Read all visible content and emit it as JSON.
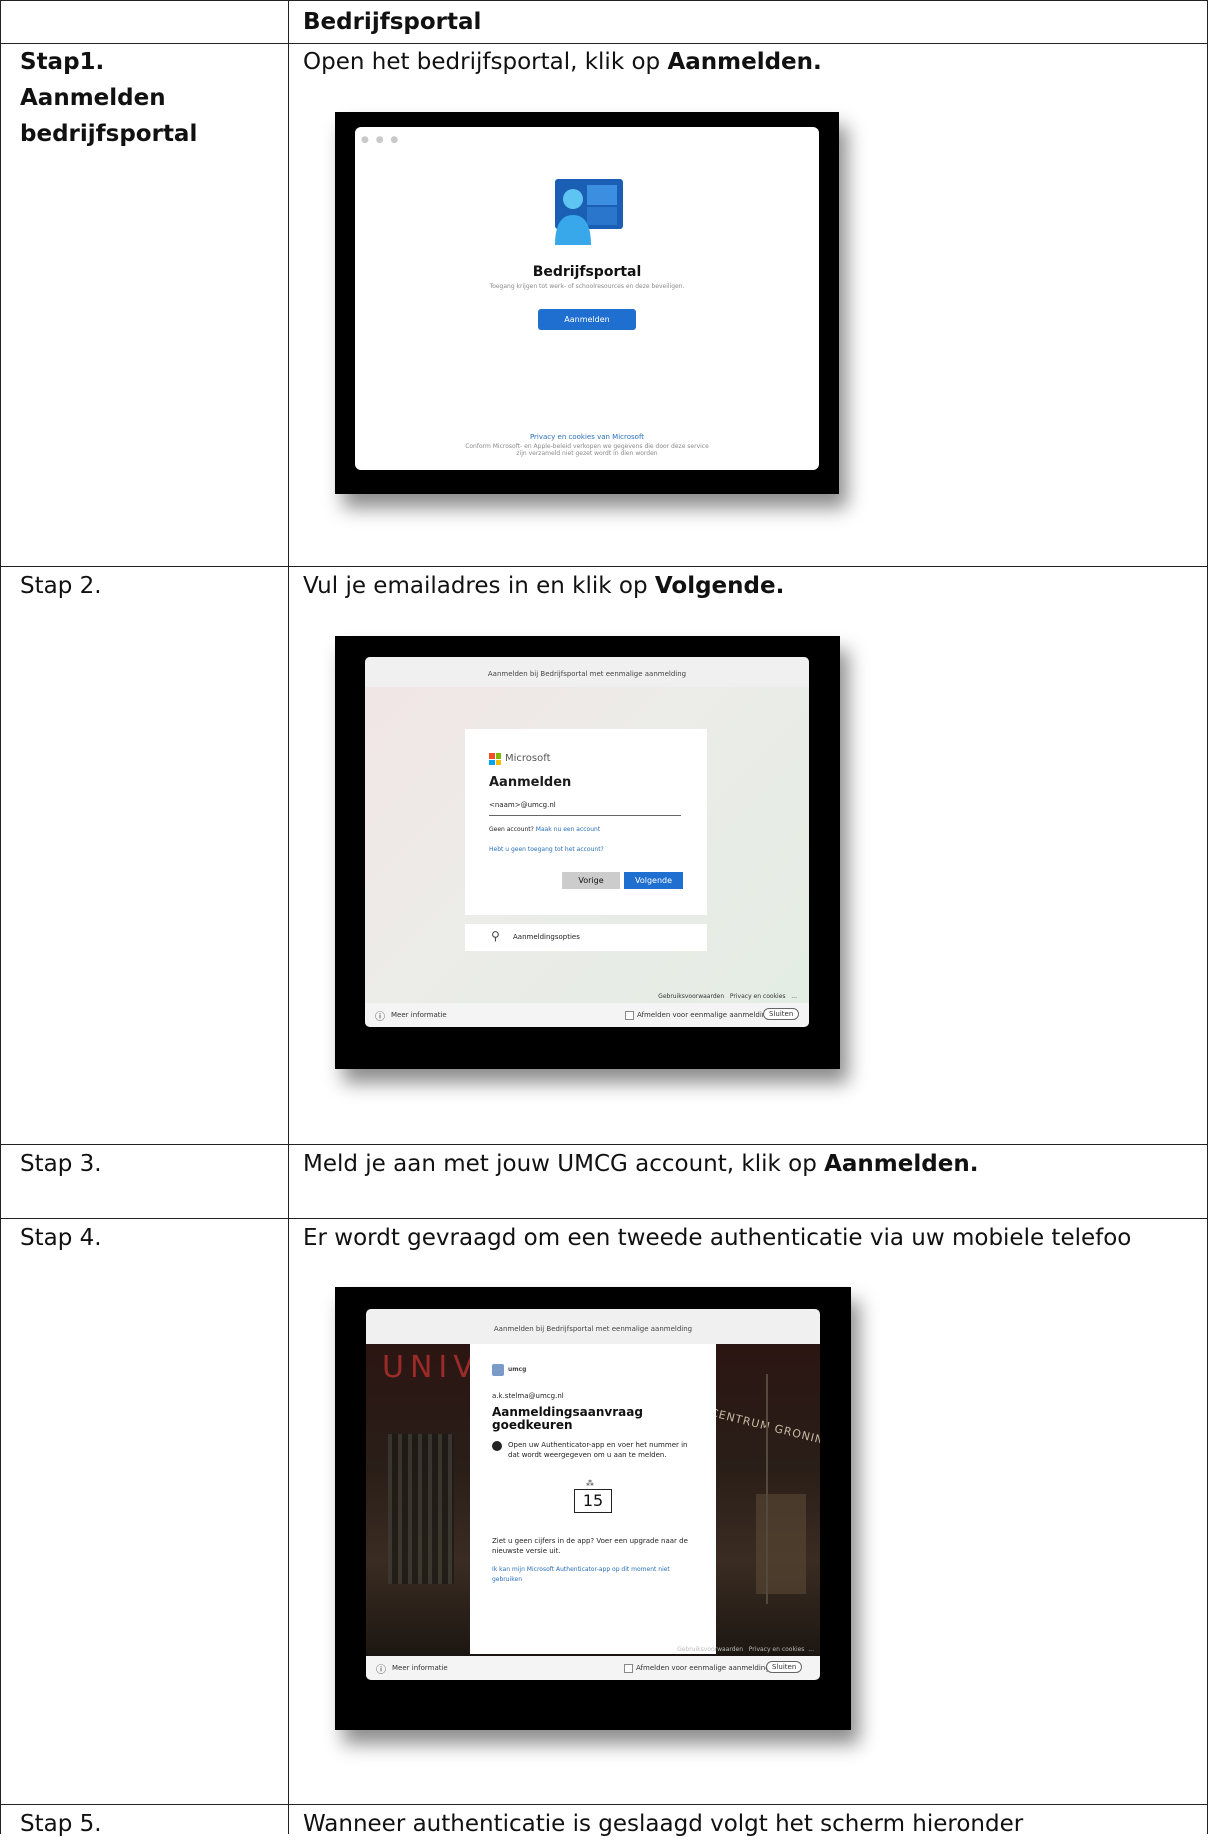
{
  "table": {
    "header": "Bedrijfsportal",
    "rows": [
      {
        "label_lines": [
          "Stap1.",
          "Aanmelden",
          "bedrijfsportal"
        ],
        "instruction_prefix": "Open het bedrijfsportal, klik op ",
        "instruction_bold": "Aanmelden."
      },
      {
        "label": "Stap 2.",
        "instruction_prefix": "Vul je emailadres in en klik op ",
        "instruction_bold": "Volgende."
      },
      {
        "label": "Stap 3.",
        "instruction_prefix": "Meld je aan met jouw UMCG account, klik op ",
        "instruction_bold": "Aanmelden."
      },
      {
        "label": "Stap 4.",
        "instruction": "Er wordt gevraagd om een tweede authenticatie via uw mobiele telefoo"
      },
      {
        "label": "Stap 5.",
        "instruction": "Wanneer authenticatie is geslaagd volgt het scherm hieronder"
      }
    ]
  },
  "screenshot1": {
    "title": "Bedrijfsportal",
    "subtitle": "Toegang krijgen tot werk- of schoolresources en deze beveiligen.",
    "button": "Aanmelden",
    "privacy_link": "Privacy en cookies van Microsoft",
    "consent_line1": "Conform Microsoft- en Apple-beleid verkopen we gegevens die door deze service",
    "consent_line2": "zijn verzameld niet gezet wordt in dien worden"
  },
  "screenshot2": {
    "topbar": "Aanmelden bij Bedrijfsportal met eenmalige aanmelding",
    "brand": "Microsoft",
    "heading": "Aanmelden",
    "email": "<naam>@umcg.nl",
    "no_account": "Geen account?",
    "create_account": "Maak nu een account",
    "no_access": "Hebt u geen toegang tot het account?",
    "back": "Vorige",
    "next": "Volgende",
    "options": "Aanmeldingsopties",
    "terms": "Gebruiksvoorwaarden",
    "privacy": "Privacy en cookies",
    "more": "...",
    "more_info": "Meer informatie",
    "sso_signout": "Afmelden voor eenmalige aanmelding",
    "close": "Sluiten"
  },
  "screenshot3": {
    "topbar": "Aanmelden bij Bedrijfsportal met eenmalige aanmelding",
    "building_text_left": "UNIV",
    "building_text_right": "CENTRUM GRONINGEN",
    "org": "umcg",
    "account": "a.k.stelma@umcg.nl",
    "heading": "Aanmeldingsaanvraag goedkeuren",
    "instruction": "Open uw Authenticator-app en voer het nummer in dat wordt weergegeven om u aan te melden.",
    "number": "15",
    "no_numbers": "Ziet u geen cijfers in de app? Voer een upgrade naar de nieuwste versie uit.",
    "cant_use": "Ik kan mijn Microsoft Authenticator-app op dit moment niet gebruiken",
    "terms": "Gebruiksvoorwaarden",
    "privacy": "Privacy en cookies",
    "more": "...",
    "more_info": "Meer informatie",
    "sso_signout": "Afmelden voor eenmalige aanmelding",
    "close": "Sluiten"
  },
  "colors": {
    "accent": "#1f6fd1",
    "link": "#2a6fb8",
    "border": "#222222"
  }
}
